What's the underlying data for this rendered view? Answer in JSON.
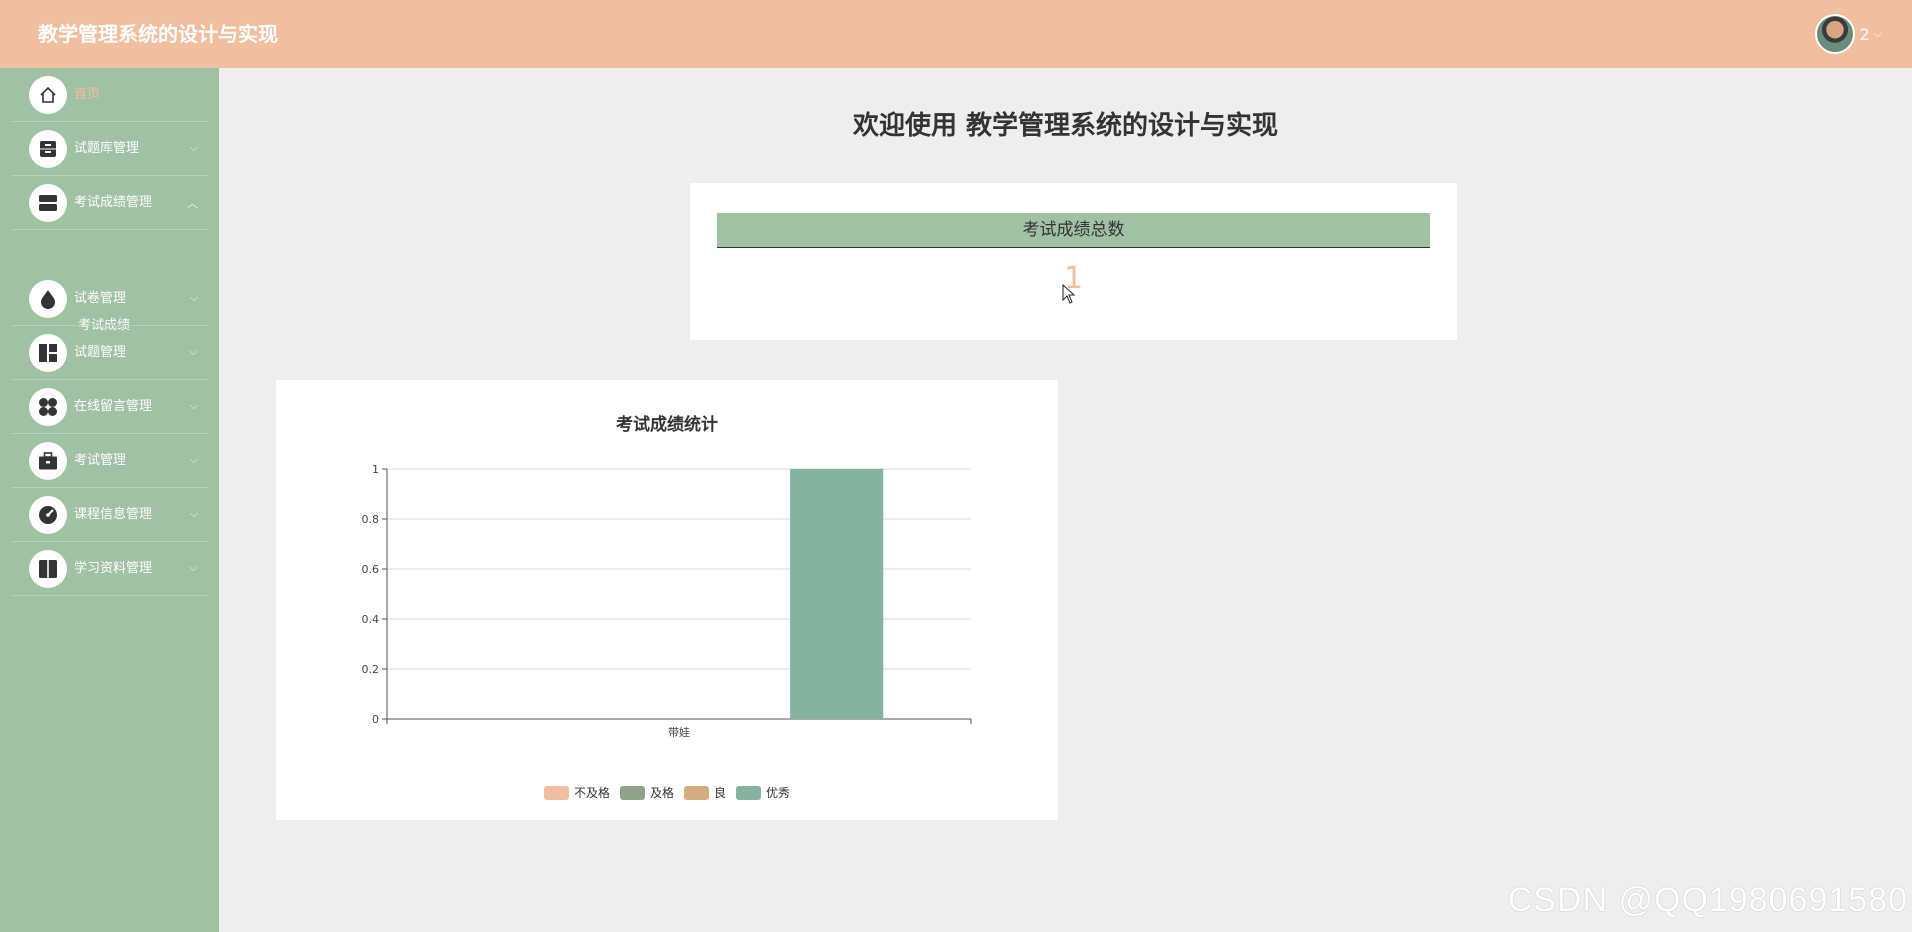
{
  "header": {
    "app_title": "教学管理系统的设计与实现",
    "user_name": "2",
    "caret": "⌵"
  },
  "sidebar": {
    "items": [
      {
        "label": "首页",
        "icon": "home-icon",
        "active": true
      },
      {
        "label": "试题库管理",
        "icon": "drawer-icon"
      },
      {
        "label": "考试成绩管理",
        "icon": "layers-icon",
        "expanded": true
      },
      {
        "label": "试卷管理",
        "icon": "drop-icon"
      },
      {
        "label": "试题管理",
        "icon": "layout-icon"
      },
      {
        "label": "在线留言管理",
        "icon": "clover-icon"
      },
      {
        "label": "考试管理",
        "icon": "briefcase-icon"
      },
      {
        "label": "课程信息管理",
        "icon": "gauge-icon"
      },
      {
        "label": "学习资料管理",
        "icon": "book-icon"
      }
    ],
    "submenu": {
      "label": "考试成绩"
    },
    "arrow_down": "⌵",
    "arrow_up": "︿"
  },
  "main": {
    "welcome": "欢迎使用 教学管理系统的设计与实现",
    "stat": {
      "label": "考试成绩总数",
      "value": "1"
    }
  },
  "chart_data": {
    "type": "bar",
    "title": "考试成绩统计",
    "categories": [
      "带娃"
    ],
    "series": [
      {
        "name": "不及格",
        "color": "#f0bf9f",
        "values": [
          0
        ]
      },
      {
        "name": "及格",
        "color": "#8fa38b",
        "values": [
          0
        ]
      },
      {
        "name": "良",
        "color": "#d5ac82",
        "values": [
          0
        ]
      },
      {
        "name": "优秀",
        "color": "#84b29e",
        "values": [
          1
        ]
      }
    ],
    "ylim": [
      0,
      1
    ],
    "yticks": [
      "0",
      "0.2",
      "0.4",
      "0.6",
      "0.8",
      "1"
    ],
    "ytick_values": [
      0,
      0.2,
      0.4,
      0.6,
      0.8,
      1
    ],
    "grid": true,
    "legend": "bottom"
  },
  "watermark": "CSDN @QQ1980691580"
}
